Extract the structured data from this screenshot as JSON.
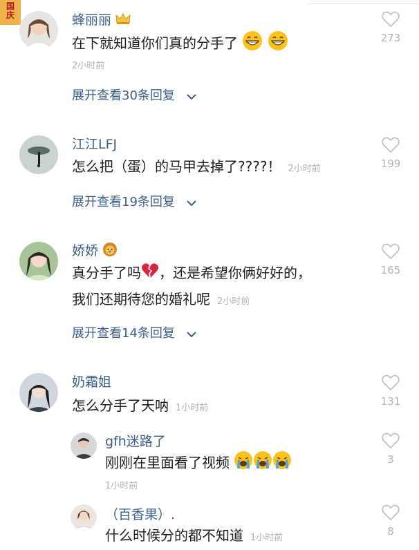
{
  "badge": {
    "line1": "国",
    "line2": "庆"
  },
  "comments": [
    {
      "name": "蜂丽丽",
      "text": "在下就知道你们真的分手了",
      "time": "2小时前",
      "expand": "展开查看30条回复",
      "likes": "273"
    },
    {
      "name": "江江LFJ",
      "text": "怎么把（蛋）的马甲去掉了????！",
      "time": "2小时前",
      "expand": "展开查看19条回复",
      "likes": "199"
    },
    {
      "name": "娇娇",
      "text_line1_a": "真分手了吗",
      "text_line1_b": "，还是希望你俩好好的，",
      "text_line2": "我们还期待您的婚礼呢",
      "time": "2小时前",
      "expand": "展开查看14条回复",
      "likes": "165"
    },
    {
      "name": "奶霜姐",
      "text": "怎么分手了天呐",
      "time": "1小时前",
      "likes": "131"
    },
    {
      "name": "gfh迷路了",
      "text": "刚刚在里面看了视频",
      "time": "1小时前",
      "likes": "3"
    },
    {
      "name": "（百香果）.",
      "text": "什么时候分的都不知道",
      "time": "1小时前",
      "likes": "8"
    }
  ],
  "colors": {
    "name": "#3a5f8a",
    "text": "#1f1f1f",
    "meta": "#b3b3b3",
    "badge_bg": "#f0b24a",
    "badge_text": "#b0161a"
  },
  "icons": [
    "crown-icon",
    "grin-emoji",
    "heart-outline-icon",
    "chevron-down-icon",
    "lion-emoji",
    "broken-heart-emoji",
    "crying-emoji"
  ]
}
